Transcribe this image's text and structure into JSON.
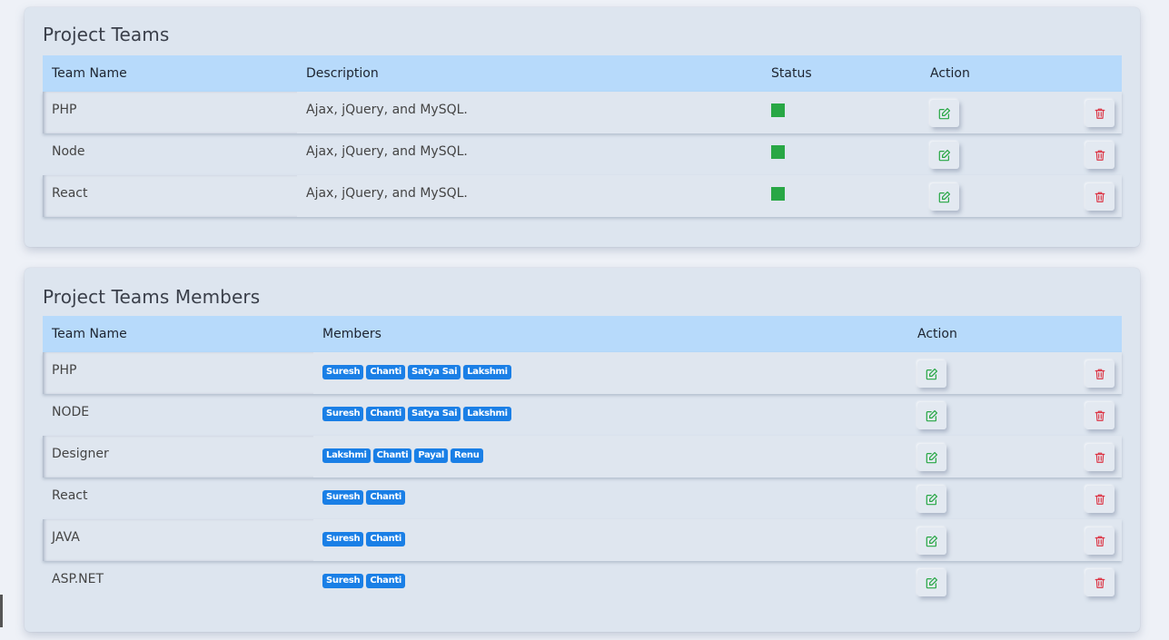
{
  "teams": {
    "title": "Project Teams",
    "headers": {
      "name": "Team Name",
      "description": "Description",
      "status": "Status",
      "action": "Action"
    },
    "rows": [
      {
        "name": "PHP",
        "description": "Ajax, jQuery, and MySQL.",
        "status": "active"
      },
      {
        "name": "Node",
        "description": "Ajax, jQuery, and MySQL.",
        "status": "active"
      },
      {
        "name": "React",
        "description": "Ajax, jQuery, and MySQL.",
        "status": "active"
      }
    ]
  },
  "members": {
    "title": "Project Teams Members",
    "headers": {
      "name": "Team Name",
      "members": "Members",
      "action": "Action"
    },
    "rows": [
      {
        "name": "PHP",
        "members": [
          "Suresh",
          "Chanti",
          "Satya Sai",
          "Lakshmi"
        ]
      },
      {
        "name": "NODE",
        "members": [
          "Suresh",
          "Chanti",
          "Satya Sai",
          "Lakshmi"
        ]
      },
      {
        "name": "Designer",
        "members": [
          "Lakshmi",
          "Chanti",
          "Payal",
          "Renu"
        ]
      },
      {
        "name": "React",
        "members": [
          "Suresh",
          "Chanti"
        ]
      },
      {
        "name": "JAVA",
        "members": [
          "Suresh",
          "Chanti"
        ]
      },
      {
        "name": "ASP.NET",
        "members": [
          "Suresh",
          "Chanti"
        ]
      }
    ]
  },
  "colors": {
    "header_bg": "#b7dafb",
    "status_active": "#28a745",
    "badge_bg": "#1a7fe6",
    "edit_icon": "#28a745",
    "delete_icon": "#dc3545"
  },
  "icons": {
    "edit": "edit-icon",
    "delete": "trash-icon"
  }
}
